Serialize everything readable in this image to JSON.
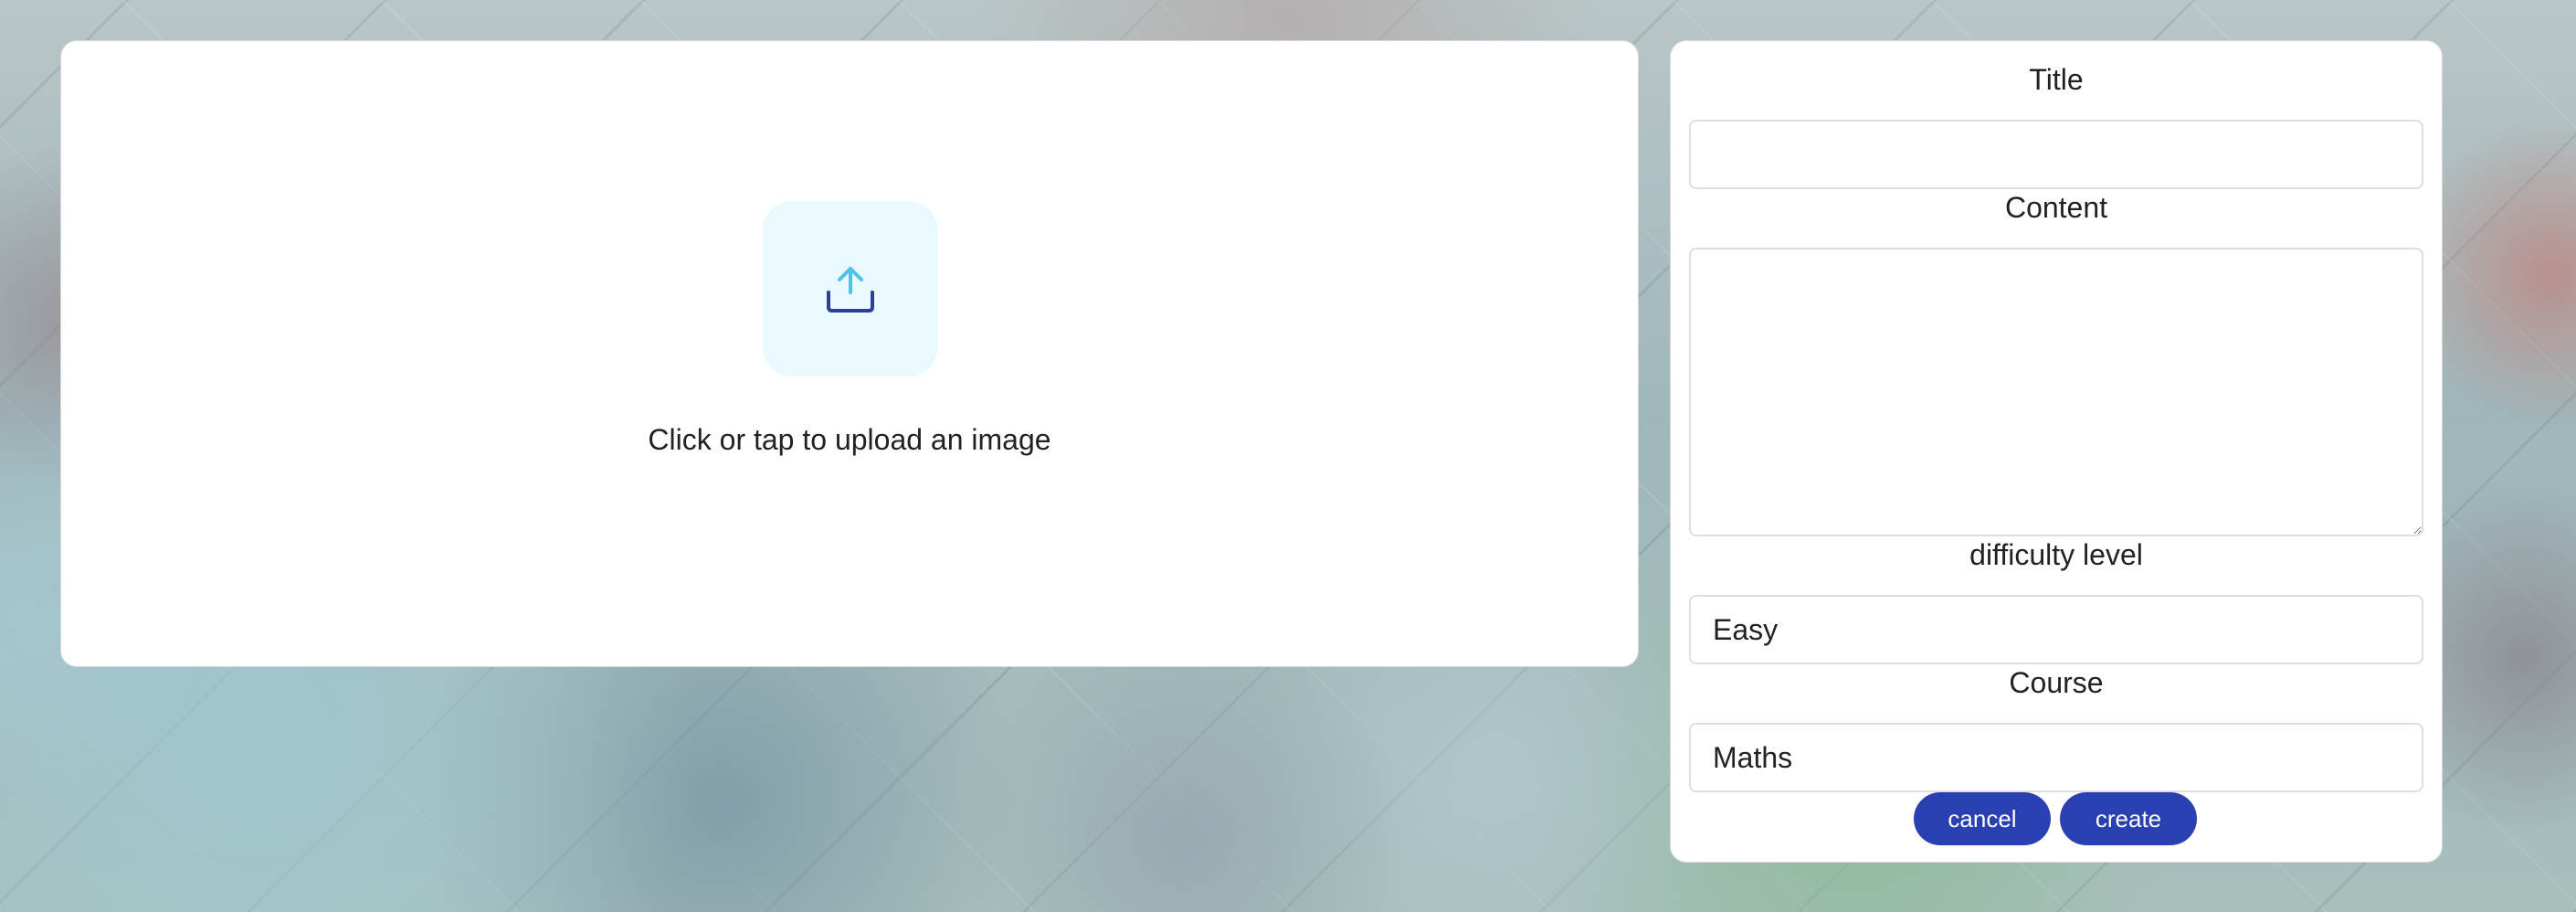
{
  "upload": {
    "label": "Click or tap to upload an image",
    "icon": "upload-icon"
  },
  "form": {
    "title_label": "Title",
    "title_value": "",
    "content_label": "Content",
    "content_value": "",
    "difficulty_label": "difficulty level",
    "difficulty_value": "Easy",
    "course_label": "Course",
    "course_value": "Maths",
    "cancel_label": "cancel",
    "create_label": "create"
  },
  "colors": {
    "button": "#2a40b0",
    "upload_icon_bg": "#eaf9fd",
    "upload_arrow": "#4cc3ea",
    "upload_tray": "#2a3f9e"
  }
}
